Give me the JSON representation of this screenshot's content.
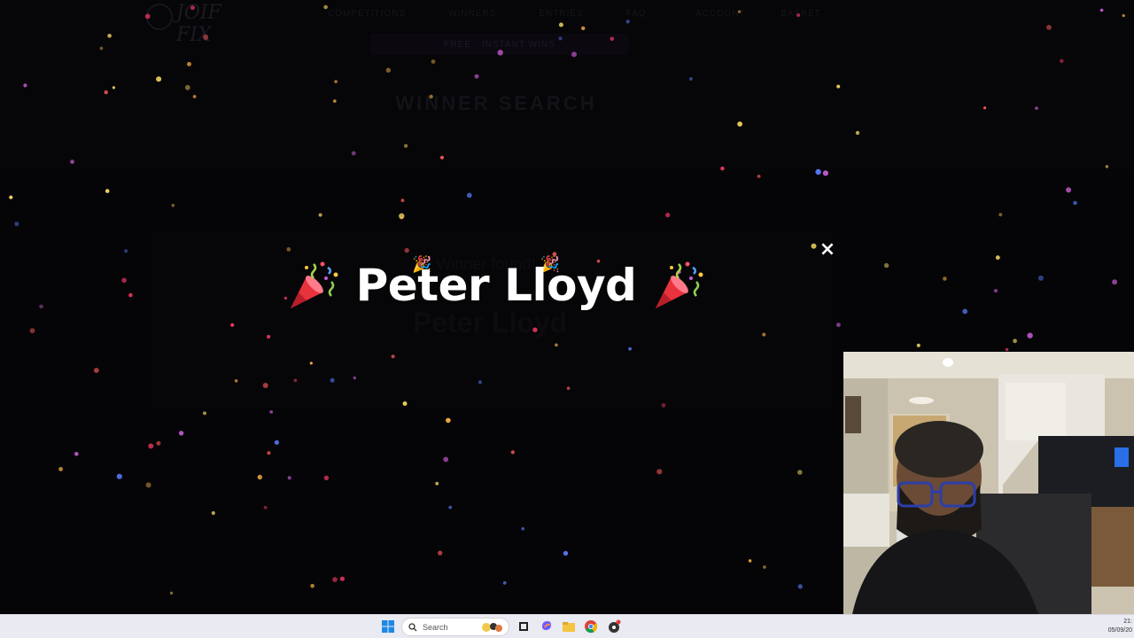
{
  "site": {
    "logo_text": "JOIF FIX",
    "nav": [
      "COMPETITIONS",
      "WINNERS",
      "ENTRIES",
      "FAQ"
    ],
    "nav_right": [
      "ACCOUNT",
      "BASKET"
    ],
    "promo": "FREE · INSTANT WINS",
    "page_heading": "WINNER SEARCH",
    "card_subtitle": "🎉 Winner found! 🎉",
    "card_winner": "Peter Lloyd"
  },
  "modal": {
    "winner_name": "Peter Lloyd",
    "close_symbol": "×",
    "popper_icon": "party-popper-icon"
  },
  "taskbar": {
    "search_label": "Search",
    "clock_time": "21:",
    "clock_date": "05/09/20"
  },
  "colors": {
    "confetti": [
      "#ff3b6b",
      "#ffb347",
      "#5a7cff",
      "#c95bd6",
      "#ffe066",
      "#ff5a5a"
    ]
  }
}
